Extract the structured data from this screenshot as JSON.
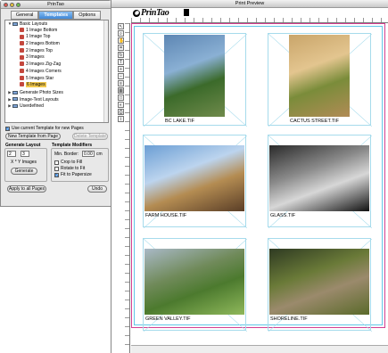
{
  "palette": {
    "title": "PrinTao",
    "tabs": [
      {
        "label": "General"
      },
      {
        "label": "Templates"
      },
      {
        "label": "Options"
      }
    ],
    "tree": [
      {
        "label": "Basic Layouts",
        "level": 0,
        "disc": "▼",
        "type": "folder"
      },
      {
        "label": "1 Image Bottom",
        "level": 1,
        "type": "template"
      },
      {
        "label": "1 Image Top",
        "level": 1,
        "type": "template"
      },
      {
        "label": "2 Images Bottom",
        "level": 1,
        "type": "template"
      },
      {
        "label": "2 Images Top",
        "level": 1,
        "type": "template"
      },
      {
        "label": "3 Images",
        "level": 1,
        "type": "template"
      },
      {
        "label": "3 Images Zig-Zag",
        "level": 1,
        "type": "template"
      },
      {
        "label": "4 Images Corners",
        "level": 1,
        "type": "template"
      },
      {
        "label": "5 Images Star",
        "level": 1,
        "type": "template"
      },
      {
        "label": "6 Images",
        "level": 1,
        "type": "template",
        "selected": true
      },
      {
        "label": "Generate Photo Sizes",
        "level": 0,
        "disc": "▶",
        "type": "folder"
      },
      {
        "label": "Image-Text Layouts",
        "level": 0,
        "disc": "▶",
        "type": "folder"
      },
      {
        "label": "Userdefined",
        "level": 0,
        "disc": "▶",
        "type": "folder"
      }
    ],
    "use_template_label": "Use current Template for new Pages",
    "new_template_label": "New Template from Page",
    "delete_template_label": "Delete Template",
    "generate_layout": {
      "heading": "Generate Layout",
      "x_value": "2",
      "y_value": "3",
      "xy_label": "X * Y Images",
      "generate_label": "Generate"
    },
    "modifiers": {
      "heading": "Template Modifiers",
      "min_border_label": "Min. Border:",
      "min_border_value": "0.00",
      "unit": "cm",
      "crop_label": "Crop to Fill",
      "rotate_label": "Rotate to Fit",
      "fit_label": "Fit to Papersize"
    },
    "apply_label": "Apply to all Pages",
    "undo_label": "Undo"
  },
  "preview": {
    "title": "Print Preview",
    "logo_text": "PrinTao",
    "status": "",
    "photos": [
      {
        "caption": "BC LAKE.TIF",
        "colors": [
          "#5d86b3",
          "#8ab0d4",
          "#3b6a2a",
          "#6f8a4b"
        ]
      },
      {
        "caption": "CACTUS STREET.TIF",
        "colors": [
          "#c9a56a",
          "#e3c58f",
          "#7a8c3a",
          "#b18b55"
        ]
      },
      {
        "caption": "FARM HOUSE.TIF",
        "colors": [
          "#6b9ed4",
          "#bcd4ee",
          "#b48c52",
          "#5a3e27"
        ]
      },
      {
        "caption": "GLASS.TIF",
        "colors": [
          "#2a2a2a",
          "#8a8a8a",
          "#d7d7d7",
          "#111111"
        ]
      },
      {
        "caption": "GREEN VALLEY.TIF",
        "colors": [
          "#a9b9c7",
          "#708a5a",
          "#4c7a2e",
          "#8fb85b"
        ]
      },
      {
        "caption": "SHORELINE.TIF",
        "colors": [
          "#2e3a22",
          "#6a7a38",
          "#9b8a6c",
          "#5a6a2a"
        ]
      }
    ]
  }
}
